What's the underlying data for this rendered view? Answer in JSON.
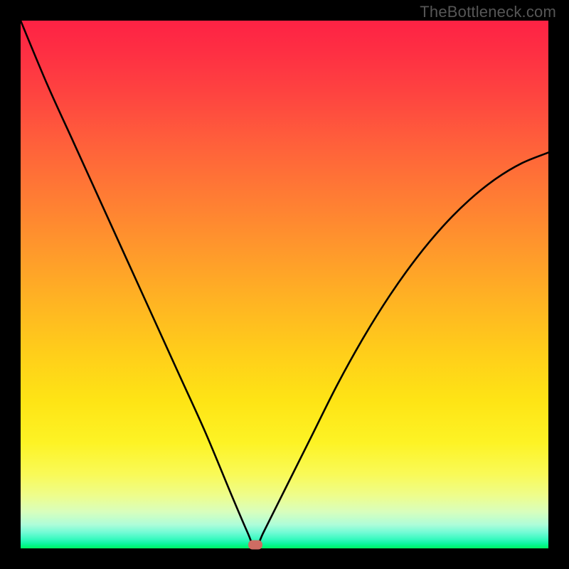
{
  "watermark": "TheBottleneck.com",
  "chart_data": {
    "type": "line",
    "title": "",
    "xlabel": "",
    "ylabel": "",
    "xlim": [
      0,
      100
    ],
    "ylim": [
      0,
      100
    ],
    "grid": false,
    "notes": "V-shaped bottleneck curve. Y represents bottleneck percentage; background gradient encodes severity (red high, green low). Minimum at roughly x≈44.5 where bottleneck ≈0%. Axes are unlabeled and unticked.",
    "series": [
      {
        "name": "bottleneck-curve",
        "x": [
          0,
          5,
          10,
          15,
          20,
          25,
          30,
          35,
          40,
          43,
          44.5,
          46,
          50,
          55,
          60,
          65,
          70,
          75,
          80,
          85,
          90,
          95,
          100
        ],
        "values": [
          100,
          88,
          77,
          66,
          55,
          44,
          33,
          22,
          10,
          3,
          0,
          3,
          11,
          21,
          31,
          40,
          48,
          55,
          61,
          66,
          70,
          73,
          75
        ]
      }
    ],
    "min_point": {
      "x": 44.5,
      "y": 0
    },
    "marker_color": "#cf6c63",
    "curve_color": "#000000"
  }
}
